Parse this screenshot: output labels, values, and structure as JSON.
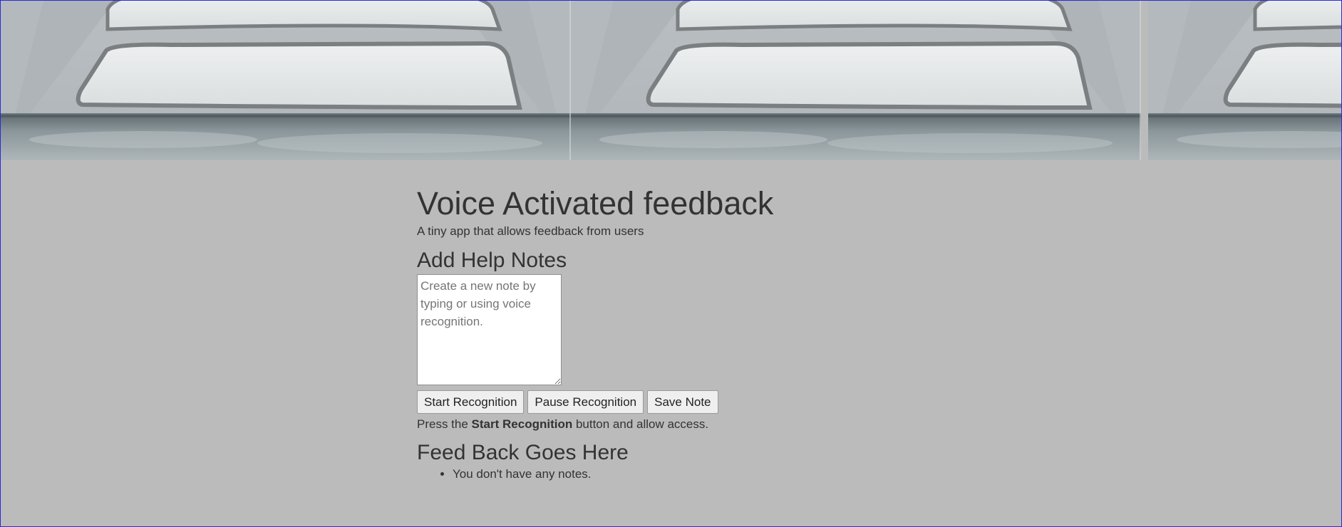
{
  "header": {
    "title": "Voice Activated feedback",
    "subtitle": "A tiny app that allows feedback from users"
  },
  "notes_form": {
    "heading": "Add Help Notes",
    "textarea_placeholder": "Create a new note by typing or using voice recognition.",
    "textarea_value": ""
  },
  "toolbar": {
    "start_label": "Start Recognition",
    "pause_label": "Pause Recognition",
    "save_label": "Save Note"
  },
  "instructions": {
    "prefix": "Press the ",
    "emphasis": "Start Recognition",
    "suffix": " button and allow access."
  },
  "feedback": {
    "heading": "Feed Back Goes Here",
    "items": [
      "You don't have any notes."
    ]
  },
  "colors": {
    "background": "#bbbbbb",
    "text": "#333333",
    "border_accent": "#2a2adb"
  }
}
